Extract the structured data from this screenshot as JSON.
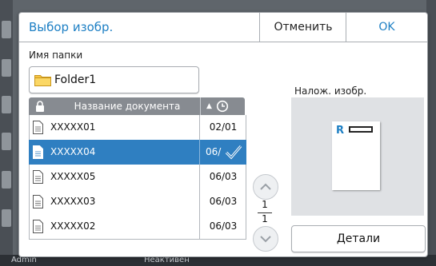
{
  "dialog": {
    "title": "Выбор изобр.",
    "cancel_label": "Отменить",
    "ok_label": "OK"
  },
  "folder": {
    "label": "Имя папки",
    "name": "Folder1"
  },
  "table": {
    "header_name": "Название документа",
    "sort_arrow": "▲",
    "rows": [
      {
        "name": "XXXXX01",
        "date": "02/01",
        "selected": false
      },
      {
        "name": "XXXXX04",
        "date": "06/",
        "selected": true
      },
      {
        "name": "XXXXX05",
        "date": "06/03",
        "selected": false
      },
      {
        "name": "XXXXX03",
        "date": "06/03",
        "selected": false
      },
      {
        "name": "XXXXX02",
        "date": "06/03",
        "selected": false
      }
    ]
  },
  "pagination": {
    "current": "1",
    "total": "1"
  },
  "overlay": {
    "label": "Налож. изобр.",
    "paper_letter": "R"
  },
  "details_label": "Детали",
  "status_bar": {
    "user": "Admin",
    "state": "Неактивен"
  },
  "colors": {
    "accent": "#1d7fc4",
    "selected_row": "#2f7fc1",
    "header": "#878b91"
  }
}
